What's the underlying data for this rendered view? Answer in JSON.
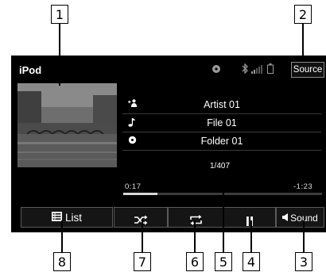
{
  "callouts": [
    "1",
    "2",
    "3",
    "4",
    "5",
    "6",
    "7",
    "8"
  ],
  "header": {
    "title": "iPod",
    "source_label": "Source"
  },
  "track": {
    "artist": "Artist 01",
    "file": "File 01",
    "folder": "Folder 01"
  },
  "counter": "1/407",
  "progress": {
    "elapsed": "0:17",
    "remaining": "-1:23",
    "fraction": 0.17
  },
  "controls": {
    "list_label": "List",
    "sound_label": "Sound"
  },
  "icons": [
    "cd-icon",
    "bluetooth-icon",
    "signal-icon",
    "battery-icon",
    "artist-icon",
    "music-note-icon",
    "folder-disc-icon",
    "list-icon",
    "shuffle-icon",
    "repeat-icon",
    "pause-icon",
    "speaker-icon"
  ],
  "colors": {
    "screen_bg": "#000000",
    "button_bg": "#151515",
    "button_border": "#5a5a5a",
    "text": "#ffffff"
  }
}
